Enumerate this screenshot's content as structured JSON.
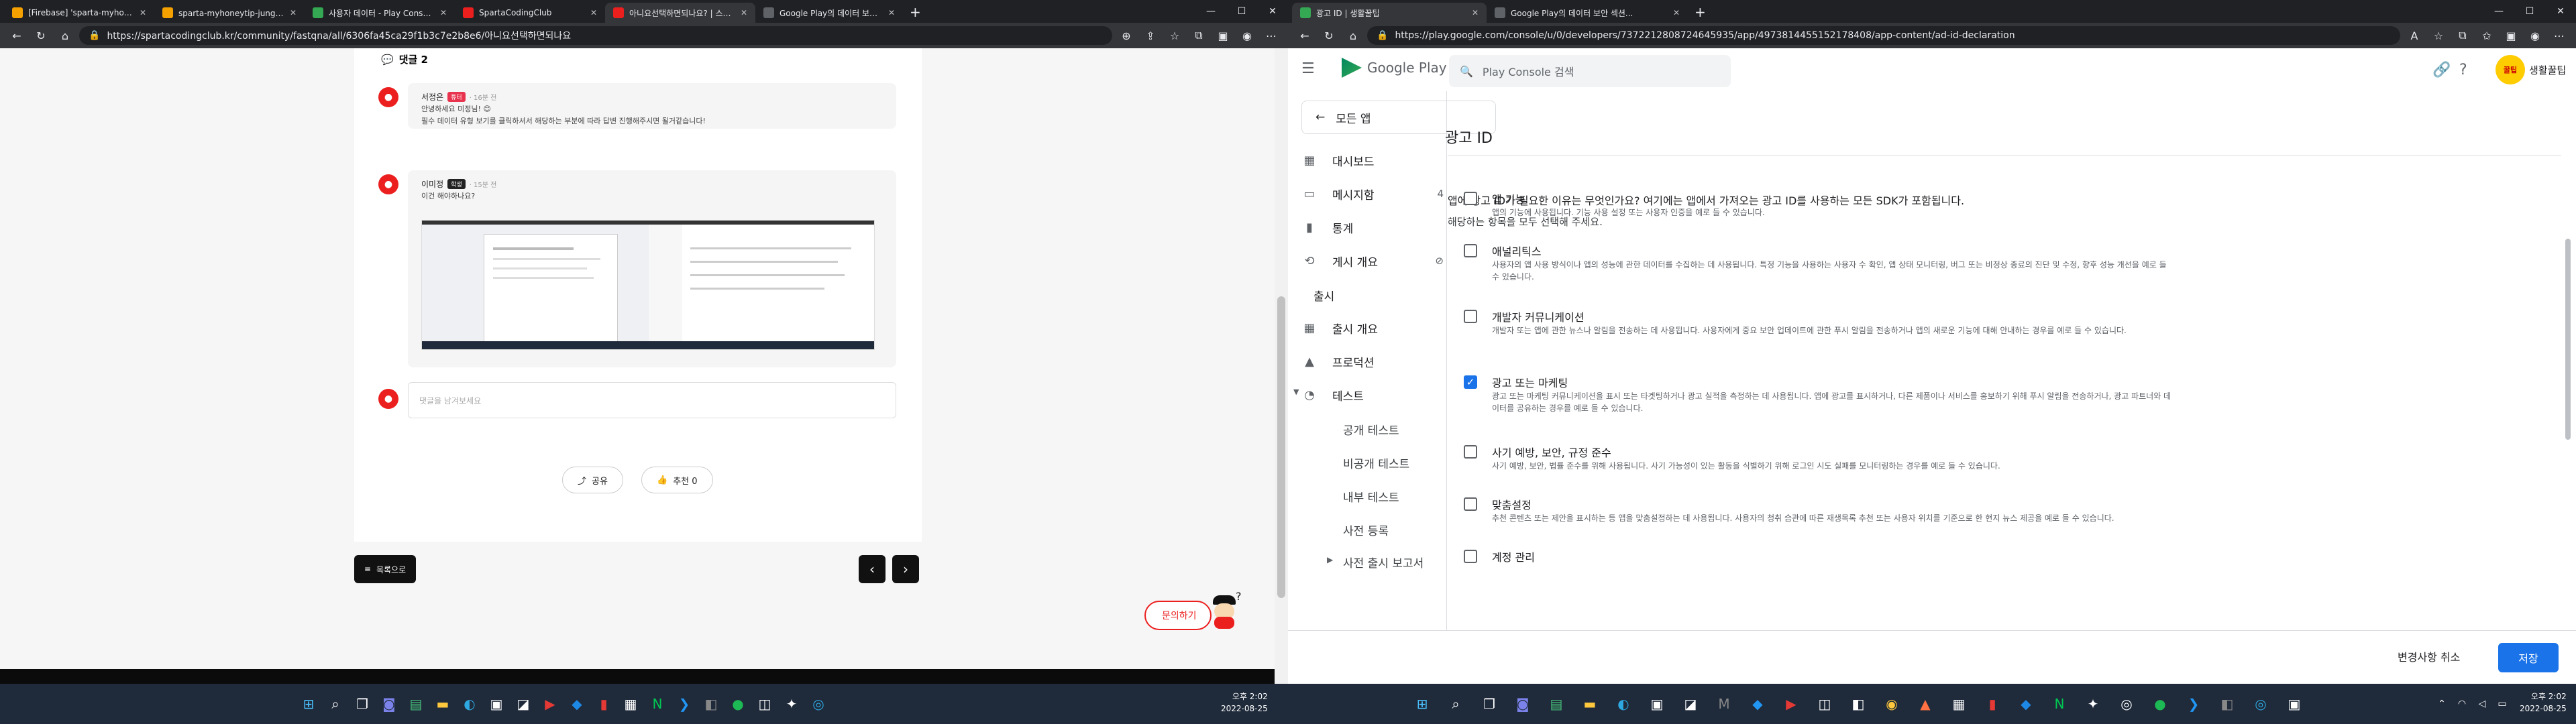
{
  "left_window": {
    "tabs": [
      {
        "title": "[Firebase] 'sparta-myhoneytip-j...",
        "color": "#f4a100"
      },
      {
        "title": "sparta-myhoneytip-jung – 실시...",
        "color": "#f4a100"
      },
      {
        "title": "사용자 데이터 - Play Console 고...",
        "color": "#34a853"
      },
      {
        "title": "SpartaCodingClub",
        "color": "#ec1f1f"
      },
      {
        "title": "아니요선택하면되나요? | 스파르...",
        "color": "#ec1f1f"
      },
      {
        "title": "Google Play의 데이터 보안 섹션...",
        "color": "#5f6368"
      }
    ],
    "url": "https://spartacodingclub.kr/community/fastqna/all/6306fa45ca29f1b3c7e2b8e6/아니요선택하면되나요",
    "comments_header": "댓글 2",
    "comments": [
      {
        "author": "서정은",
        "badge": "튜터",
        "time": "· 16분 전",
        "lines": [
          "안녕하세요 미정님! 😊",
          "필수 데이터 유형 보기를 클릭하셔서 해당하는 부분에 따라 답변 진행해주시면 될거같습니다!"
        ]
      },
      {
        "author": "이미정",
        "badge": "학생",
        "time": "· 15분 전",
        "lines": [
          "이건 해야하나요?"
        ]
      }
    ],
    "comment_placeholder": "댓글을 남겨보세요",
    "share_label": "공유",
    "recommend_label": "추천 0",
    "list_label": "목록으로",
    "ask_label": "문의하기"
  },
  "right_window": {
    "tabs": [
      {
        "title": "광고 ID | 생활꿀팁",
        "color": "#34a853"
      },
      {
        "title": "Google Play의 데이터 보안 섹션...",
        "color": "#5f6368"
      }
    ],
    "url": "https://play.google.com/console/u/0/developers/7372212808724645935/app/4973814455152178408/app-content/ad-id-declaration",
    "logo_text": "Google Play Console",
    "search_placeholder": "Play Console 검색",
    "app_name": "생활꿀팁",
    "all_apps": "모든 앱",
    "nav": [
      {
        "label": "대시보드",
        "count": ""
      },
      {
        "label": "메시지함",
        "count": "4"
      },
      {
        "label": "통계",
        "count": ""
      },
      {
        "label": "게시 개요",
        "count": ""
      }
    ],
    "release_section": "출시",
    "release_nav": [
      {
        "label": "출시 개요"
      },
      {
        "label": "프로덕션"
      },
      {
        "label": "테스트"
      }
    ],
    "test_sub": [
      "공개 테스트",
      "비공개 테스트",
      "내부 테스트",
      "사전 등록"
    ],
    "pre_launch": "사전 출시 보고서",
    "page_title": "광고 ID",
    "question": "앱에 광고 ID가 필요한 이유는 무엇인가요? 여기에는 앱에서 가져오는 광고 ID를 사용하는 모든 SDK가 포함됩니다.",
    "instruction": "해당하는 항목을 모두 선택해 주세요.",
    "options": [
      {
        "label": "앱 기능",
        "checked": false,
        "desc": "앱의 기능에 사용됩니다. 기능 사용 설정 또는 사용자 인증을 예로 들 수 있습니다."
      },
      {
        "label": "애널리틱스",
        "checked": false,
        "desc": "사용자의 앱 사용 방식이나 앱의 성능에 관한 데이터를 수집하는 데 사용됩니다. 특정 기능을 사용하는 사용자 수 확인, 앱 상태 모니터링, 버그 또는 비정상 종료의 진단 및 수정, 향후 성능 개선을 예로 들 수 있습니다."
      },
      {
        "label": "개발자 커뮤니케이션",
        "checked": false,
        "desc": "개발자 또는 앱에 관한 뉴스나 알림을 전송하는 데 사용됩니다. 사용자에게 중요 보안 업데이트에 관한 푸시 알림을 전송하거나 앱의 새로운 기능에 대해 안내하는 경우를 예로 들 수 있습니다."
      },
      {
        "label": "광고 또는 마케팅",
        "checked": true,
        "desc": "광고 또는 마케팅 커뮤니케이션을 표시 또는 타겟팅하거나 광고 실적을 측정하는 데 사용됩니다. 앱에 광고를 표시하거나, 다른 제품이나 서비스를 홍보하기 위해 푸시 알림을 전송하거나, 광고 파트너와 데이터를 공유하는 경우를 예로 들 수 있습니다."
      },
      {
        "label": "사기 예방, 보안, 규정 준수",
        "checked": false,
        "desc": "사기 예방, 보안, 법률 준수를 위해 사용됩니다. 사기 가능성이 있는 활동을 식별하기 위해 로그인 시도 실패를 모니터링하는 경우를 예로 들 수 있습니다."
      },
      {
        "label": "맞춤설정",
        "checked": false,
        "desc": "추천 콘텐츠 또는 제안을 표시하는 등 앱을 맞춤설정하는 데 사용됩니다. 사용자의 청취 습관에 따른 재생목록 추천 또는 사용자 위치를 기준으로 한 현지 뉴스 제공을 예로 들 수 있습니다."
      },
      {
        "label": "계정 관리",
        "checked": false,
        "desc": ""
      }
    ],
    "discard_label": "변경사항 취소",
    "save_label": "저장"
  },
  "taskbar": {
    "left_time": "오후 2:02",
    "left_date": "2022-08-25",
    "right_time": "오후 2:02",
    "right_date": "2022-08-25"
  },
  "colors": {
    "accent": "#1a73e8",
    "brand_red": "#ec1f1f",
    "chrome_dark": "#202124"
  }
}
